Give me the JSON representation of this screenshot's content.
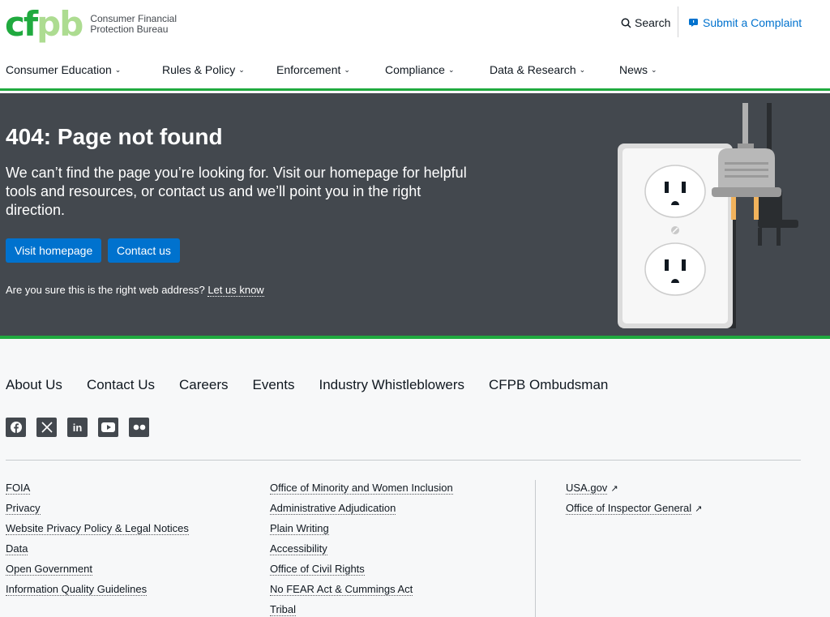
{
  "header": {
    "logo_mark_a": "cf",
    "logo_mark_b": "pb",
    "logo_line1": "Consumer Financial",
    "logo_line2": "Protection Bureau",
    "search_label": "Search",
    "complaint_label": "Submit a Complaint"
  },
  "nav": [
    {
      "label": "Consumer Education"
    },
    {
      "label": "Rules & Policy"
    },
    {
      "label": "Enforcement"
    },
    {
      "label": "Compliance"
    },
    {
      "label": "Data & Research"
    },
    {
      "label": "News"
    }
  ],
  "hero": {
    "title": "404: Page not found",
    "lead": "We can’t find the page you’re looking for. Visit our homepage for helpful tools and resources, or contact us and we’ll point you in the right direction.",
    "btn_home": "Visit homepage",
    "btn_contact": "Contact us",
    "note": "Are you sure this is the right web address?",
    "note_link": "Let us know"
  },
  "footer_nav": [
    "About Us",
    "Contact Us",
    "Careers",
    "Events",
    "Industry Whistleblowers",
    "CFPB Ombudsman"
  ],
  "social": [
    "facebook-icon",
    "x-icon",
    "linkedin-icon",
    "youtube-icon",
    "flickr-icon"
  ],
  "footer_col1": [
    "FOIA",
    "Privacy",
    "Website Privacy Policy & Legal Notices",
    "Data",
    "Open Government",
    "Information Quality Guidelines"
  ],
  "footer_col2": [
    "Office of Minority and Women Inclusion",
    "Administrative Adjudication",
    "Plain Writing",
    "Accessibility",
    "Office of Civil Rights",
    "No FEAR Act & Cummings Act",
    "Tribal"
  ],
  "footer_col3": [
    "USA.gov",
    "Office of Inspector General"
  ],
  "colors": {
    "brand_green": "#20aa3f",
    "link_blue": "#0072ce",
    "hero_bg": "#43484e"
  }
}
